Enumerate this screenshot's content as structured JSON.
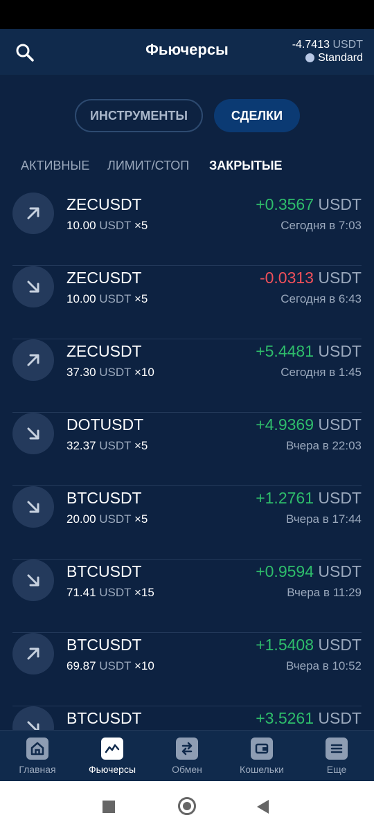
{
  "header": {
    "title": "Фьючерсы",
    "balance_value": "-4.7413",
    "balance_unit": "USDT",
    "account_type": "Standard"
  },
  "segments": {
    "tools": "ИНСТРУМЕНТЫ",
    "deals": "СДЕЛКИ"
  },
  "subtabs": {
    "active": "АКТИВНЫЕ",
    "limit": "ЛИМИТ/СТОП",
    "closed": "ЗАКРЫТЫЕ"
  },
  "trades": [
    {
      "symbol": "ZECUSDT",
      "amount": "10.00",
      "unit": "USDT",
      "leverage": "×5",
      "pnl": "+0.3567",
      "pnl_unit": "USDT",
      "time": "Сегодня в 7:03",
      "direction": "up",
      "pnl_color": "#2ebd6b"
    },
    {
      "symbol": "ZECUSDT",
      "amount": "10.00",
      "unit": "USDT",
      "leverage": "×5",
      "pnl": "-0.0313",
      "pnl_unit": "USDT",
      "time": "Сегодня в 6:43",
      "direction": "down",
      "pnl_color": "#f0505a"
    },
    {
      "symbol": "ZECUSDT",
      "amount": "37.30",
      "unit": "USDT",
      "leverage": "×10",
      "pnl": "+5.4481",
      "pnl_unit": "USDT",
      "time": "Сегодня в 1:45",
      "direction": "up",
      "pnl_color": "#2ebd6b"
    },
    {
      "symbol": "DOTUSDT",
      "amount": "32.37",
      "unit": "USDT",
      "leverage": "×5",
      "pnl": "+4.9369",
      "pnl_unit": "USDT",
      "time": "Вчера в 22:03",
      "direction": "down",
      "pnl_color": "#2ebd6b"
    },
    {
      "symbol": "BTCUSDT",
      "amount": "20.00",
      "unit": "USDT",
      "leverage": "×5",
      "pnl": "+1.2761",
      "pnl_unit": "USDT",
      "time": "Вчера в 17:44",
      "direction": "down",
      "pnl_color": "#2ebd6b"
    },
    {
      "symbol": "BTCUSDT",
      "amount": "71.41",
      "unit": "USDT",
      "leverage": "×15",
      "pnl": "+0.9594",
      "pnl_unit": "USDT",
      "time": "Вчера в 11:29",
      "direction": "down",
      "pnl_color": "#2ebd6b"
    },
    {
      "symbol": "BTCUSDT",
      "amount": "69.87",
      "unit": "USDT",
      "leverage": "×10",
      "pnl": "+1.5408",
      "pnl_unit": "USDT",
      "time": "Вчера в 10:52",
      "direction": "up",
      "pnl_color": "#2ebd6b"
    },
    {
      "symbol": "BTCUSDT",
      "amount": "",
      "unit": "",
      "leverage": "",
      "pnl": "+3.5261",
      "pnl_unit": "USDT",
      "time": "",
      "direction": "down",
      "pnl_color": "#2ebd6b"
    }
  ],
  "nav": [
    {
      "label": "Главная",
      "icon": "home-icon"
    },
    {
      "label": "Фьючерсы",
      "icon": "chart-icon"
    },
    {
      "label": "Обмен",
      "icon": "exchange-icon"
    },
    {
      "label": "Кошельки",
      "icon": "wallet-icon"
    },
    {
      "label": "Еще",
      "icon": "menu-icon"
    }
  ],
  "colors": {
    "background": "#0d2241",
    "header": "#102a4c",
    "positive": "#2ebd6b",
    "negative": "#f0505a",
    "active_segment": "#0b3a73"
  }
}
